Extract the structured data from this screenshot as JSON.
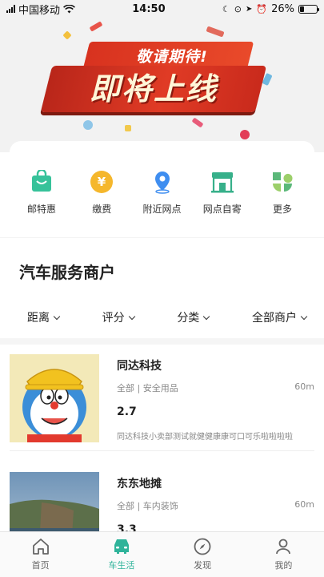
{
  "status_bar": {
    "carrier": "中国移动",
    "time": "14:50",
    "battery": "26%",
    "battery_level": 0.26
  },
  "banner": {
    "subtitle": "敬请期待!",
    "title": "即将上线"
  },
  "quick_actions": [
    {
      "label": "邮特惠",
      "icon": "shopping-bag-icon",
      "color": "#37c29a"
    },
    {
      "label": "缴费",
      "icon": "yuan-coin-icon",
      "color": "#f5b72c"
    },
    {
      "label": "附近网点",
      "icon": "location-pin-icon",
      "color": "#3f8ef0"
    },
    {
      "label": "网点自寄",
      "icon": "storefront-icon",
      "color": "#37b08a"
    },
    {
      "label": "更多",
      "icon": "grid-more-icon",
      "color": "#5bb87a"
    }
  ],
  "section": {
    "title": "汽车服务商户"
  },
  "filters": [
    "距离",
    "评分",
    "分类",
    "全部商户"
  ],
  "merchants": [
    {
      "name": "同达科技",
      "category": "全部 | 安全用品",
      "distance": "60m",
      "rating": "2.7",
      "description": "同达科技小卖部测试就健健康康可口可乐啦啦啦啦"
    },
    {
      "name": "东东地摊",
      "category": "全部 | 车内装饰",
      "distance": "60m",
      "rating": "3.3",
      "description": ""
    }
  ],
  "tabbar": [
    {
      "label": "首页",
      "icon": "home-icon",
      "active": false
    },
    {
      "label": "车生活",
      "icon": "car-icon",
      "active": true
    },
    {
      "label": "发现",
      "icon": "compass-icon",
      "active": false
    },
    {
      "label": "我的",
      "icon": "user-icon",
      "active": false
    }
  ],
  "colors": {
    "accent": "#2fb39a",
    "banner_red": "#d8321f"
  }
}
